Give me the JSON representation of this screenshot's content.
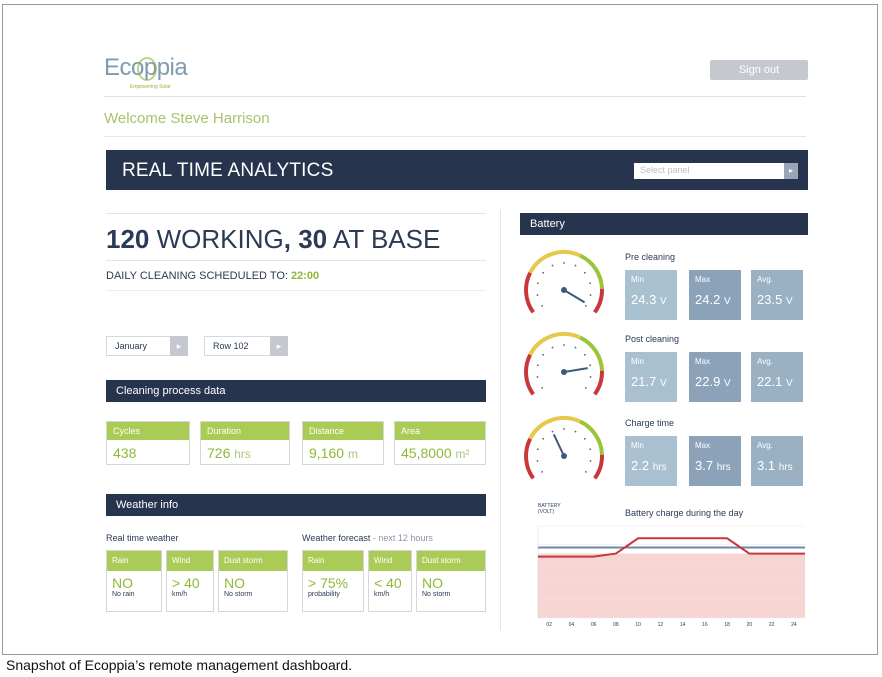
{
  "header": {
    "logo_text": "Ecoppia",
    "logo_tagline": "Empowering Solar",
    "signout_label": "Sign out",
    "welcome": "Welcome Steve Harrison"
  },
  "banner": {
    "title": "REAL TIME ANALYTICS",
    "select_placeholder": "Select panel",
    "select_arrow": "▸"
  },
  "summary": {
    "working_count": "120",
    "working_label": "WORKING",
    "base_count": "30",
    "base_label": "AT BASE",
    "schedule_label": "DAILY CLEANING SCHEDULED TO:",
    "schedule_time": "22:00"
  },
  "filters": {
    "month": "January",
    "row": "Row 102",
    "arrow": "▸"
  },
  "cleaning": {
    "title": "Cleaning process data",
    "cards": [
      {
        "label": "Cycles",
        "value": "438",
        "unit": ""
      },
      {
        "label": "Duration",
        "value": "726",
        "unit": "hrs"
      },
      {
        "label": "Distance",
        "value": "9,160",
        "unit": "m"
      },
      {
        "label": "Area",
        "value": "45,8000",
        "unit": "m²"
      }
    ]
  },
  "weather": {
    "title": "Weather info",
    "realtime_label": "Real time weather",
    "forecast_label": "Weather forecast",
    "forecast_note": "- next 12 hours",
    "realtime": [
      {
        "label": "Rain",
        "value": "NO",
        "sub": "No rain"
      },
      {
        "label": "Wind",
        "value": "> 40",
        "sub": "km/h"
      },
      {
        "label": "Dust storm",
        "value": "NO",
        "sub": "No storm"
      }
    ],
    "forecast": [
      {
        "label": "Rain",
        "value": "> 75%",
        "sub": "probability"
      },
      {
        "label": "Wind",
        "value": "< 40",
        "sub": "km/h"
      },
      {
        "label": "Dust storm",
        "value": "NO",
        "sub": "No storm"
      }
    ]
  },
  "battery": {
    "title": "Battery",
    "groups": [
      {
        "title": "Pre cleaning",
        "needle": 0.98,
        "stats": [
          {
            "label": "Min",
            "value": "24.3",
            "unit": "V"
          },
          {
            "label": "Max",
            "value": "24.2",
            "unit": "V"
          },
          {
            "label": "Avg.",
            "value": "23.5",
            "unit": "V"
          }
        ]
      },
      {
        "title": "Post cleaning",
        "needle": 0.82,
        "stats": [
          {
            "label": "Min",
            "value": "21.7",
            "unit": "V"
          },
          {
            "label": "Max",
            "value": "22.9",
            "unit": "V"
          },
          {
            "label": "Avg.",
            "value": "22.1",
            "unit": "V"
          }
        ]
      },
      {
        "title": "Charge time",
        "needle": 0.4,
        "stats": [
          {
            "label": "Min",
            "value": "2.2",
            "unit": "hrs"
          },
          {
            "label": "Max",
            "value": "3.7",
            "unit": "hrs"
          },
          {
            "label": "Avg.",
            "value": "3.1",
            "unit": "hrs"
          }
        ]
      }
    ],
    "chart_ylabel": "BATTERY",
    "chart_yunit": "(VOLT)",
    "chart_title": "Battery charge during the day"
  },
  "chart_data": {
    "type": "line",
    "title": "Battery charge during the day",
    "ylabel": "BATTERY (VOLT)",
    "x": [
      "02",
      "04",
      "06",
      "08",
      "10",
      "12",
      "14",
      "16",
      "18",
      "20",
      "22",
      "24"
    ],
    "y_ticks": [
      "",
      "",
      "",
      "",
      "",
      ""
    ],
    "ylim": [
      0,
      30
    ],
    "series": [
      {
        "values": [
          20,
          20,
          20,
          21,
          26,
          26,
          26,
          26,
          26,
          21,
          21,
          21
        ],
        "color": "#c8373b"
      },
      {
        "values": [
          23,
          23,
          23,
          23,
          23,
          23,
          23,
          23,
          23,
          23,
          23,
          23
        ],
        "color": "#6d89a8"
      }
    ],
    "colors": {
      "area": "#f7d5d3",
      "grid": "#e8e8e8"
    }
  }
}
